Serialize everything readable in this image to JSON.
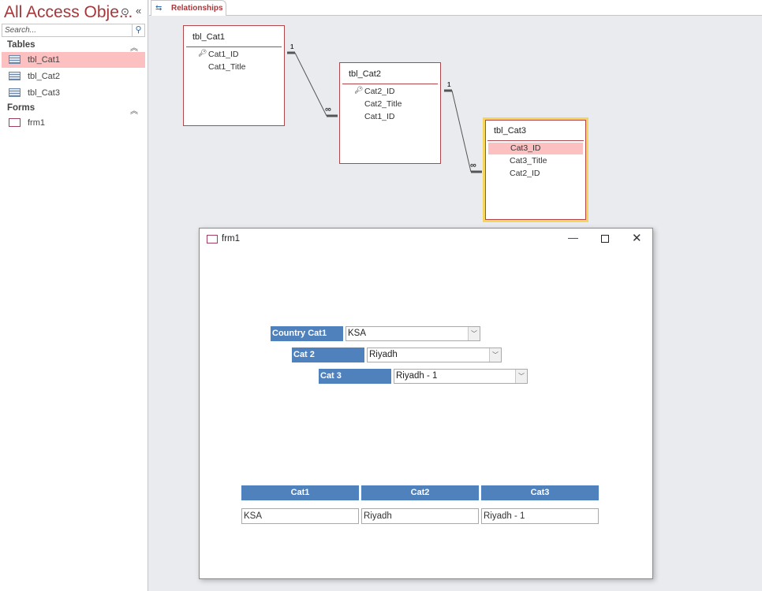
{
  "nav": {
    "title": "All Access Obje...",
    "search_placeholder": "Search...",
    "groups": [
      {
        "label": "Tables",
        "items": [
          "tbl_Cat1",
          "tbl_Cat2",
          "tbl_Cat3"
        ]
      },
      {
        "label": "Forms",
        "items": [
          "frm1"
        ]
      }
    ],
    "selected": "tbl_Cat1"
  },
  "tab": {
    "label": "Relationships"
  },
  "tables": [
    {
      "name": "tbl_Cat1",
      "fields": [
        "Cat1_ID",
        "Cat1_Title"
      ],
      "key": "Cat1_ID"
    },
    {
      "name": "tbl_Cat2",
      "fields": [
        "Cat2_ID",
        "Cat2_Title",
        "Cat1_ID"
      ],
      "key": "Cat2_ID"
    },
    {
      "name": "tbl_Cat3",
      "fields": [
        "Cat3_ID",
        "Cat3_Title",
        "Cat2_ID"
      ],
      "selected_field": "Cat3_ID"
    }
  ],
  "relationships": [
    {
      "one": "1",
      "many": "∞"
    },
    {
      "one": "1",
      "many": "∞"
    }
  ],
  "form": {
    "title": "frm1",
    "combos": [
      {
        "label": "Country Cat1",
        "value": "KSA"
      },
      {
        "label": "Cat 2",
        "value": "Riyadh"
      },
      {
        "label": "Cat 3",
        "value": "Riyadh - 1"
      }
    ],
    "headers": [
      "Cat1",
      "Cat2",
      "Cat3"
    ],
    "values": [
      "KSA",
      "Riyadh",
      "Riyadh - 1"
    ]
  },
  "colors": {
    "accent": "#a4373a",
    "label_bg": "#4f81bd",
    "selection": "#fcc0c0",
    "focus": "#f6d55c"
  }
}
